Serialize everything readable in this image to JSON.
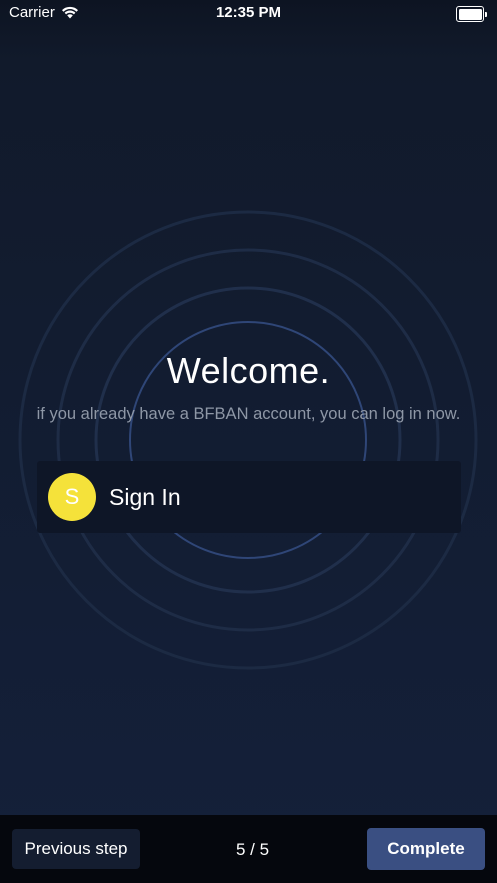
{
  "status_bar": {
    "carrier": "Carrier",
    "time": "12:35 PM",
    "wifi_icon": "wifi-icon",
    "battery_icon": "battery-icon",
    "battery_level": 1.0
  },
  "welcome": {
    "title": "Welcome.",
    "subtitle": "if you already have a BFBAN account, you can log in now."
  },
  "signin": {
    "avatar_letter": "S",
    "label": "Sign In",
    "avatar_color": "#f5e23a"
  },
  "footer": {
    "previous_label": "Previous step",
    "step_counter": "5 / 5",
    "complete_label": "Complete"
  },
  "colors": {
    "background": "#131d2f",
    "ring": "#1f2d47",
    "ring_inner": "#3b5390",
    "complete_button": "#3a4f82",
    "bottom_bar": "#05070d"
  }
}
